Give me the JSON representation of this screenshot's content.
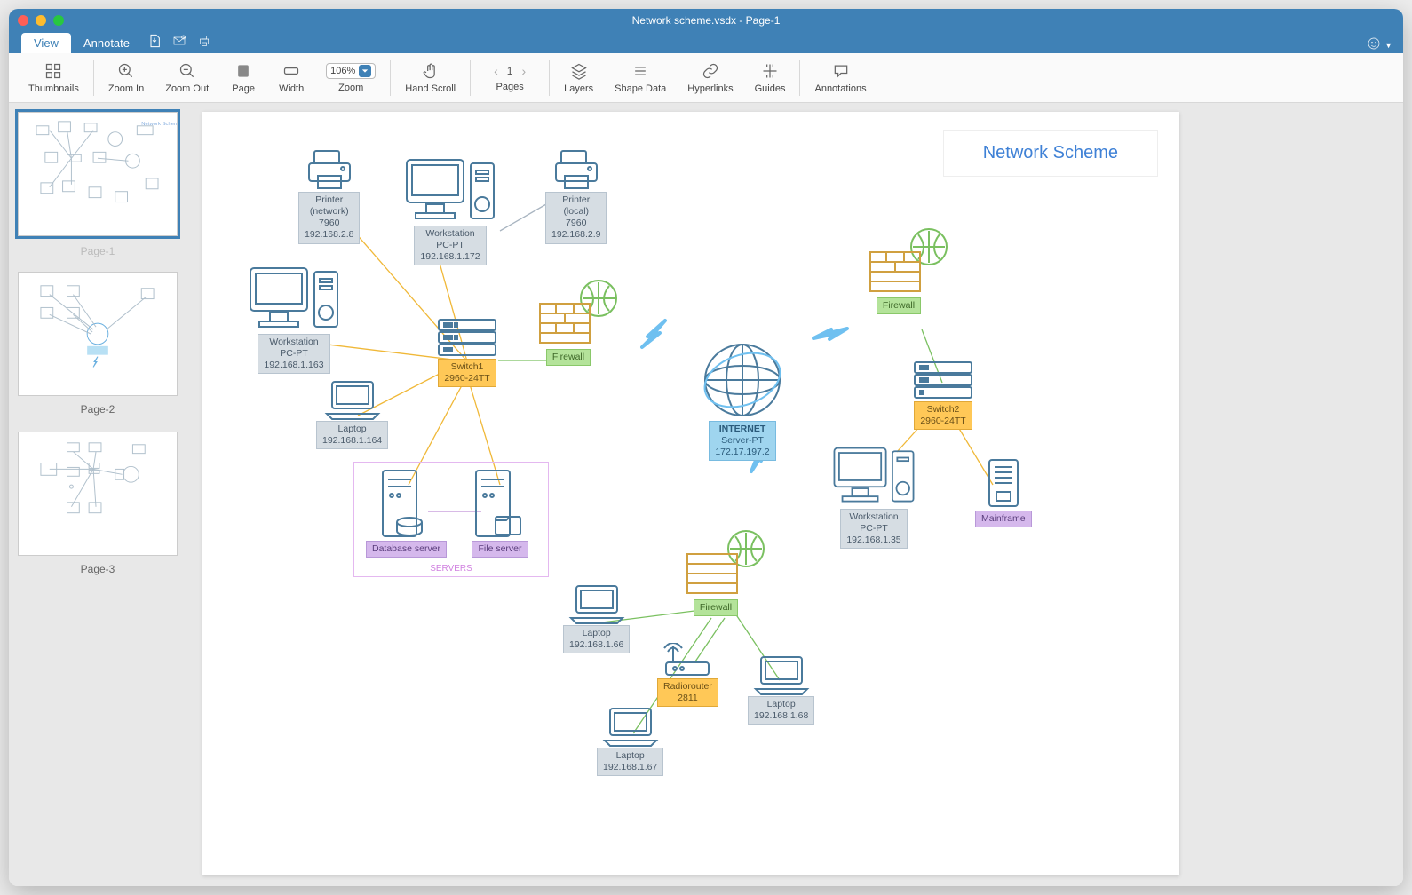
{
  "window": {
    "title": "Network scheme.vsdx - Page-1"
  },
  "tabs": {
    "view": "View",
    "annotate": "Annotate"
  },
  "toolbar": {
    "thumbnails": "Thumbnails",
    "zoom_in": "Zoom In",
    "zoom_out": "Zoom Out",
    "page": "Page",
    "width": "Width",
    "zoom": "Zoom",
    "zoom_value": "106%",
    "hand_scroll": "Hand Scroll",
    "pages": "Pages",
    "page_current": "1",
    "layers": "Layers",
    "shape_data": "Shape Data",
    "hyperlinks": "Hyperlinks",
    "guides": "Guides",
    "annotations": "Annotations"
  },
  "thumbs": {
    "p1": "Page-1",
    "p2": "Page-2",
    "p3": "Page-3"
  },
  "diagram": {
    "title": "Network Scheme",
    "servers_caption": "SERVERS",
    "nodes": {
      "printer_net": {
        "l1": "Printer",
        "l2": "(network)",
        "l3": "7960",
        "l4": "192.168.2.8"
      },
      "printer_local": {
        "l1": "Printer",
        "l2": "(local)",
        "l3": "7960",
        "l4": "192.168.2.9"
      },
      "workstation1": {
        "l1": "Workstation",
        "l2": "PC-PT",
        "l3": "192.168.1.172"
      },
      "workstation2": {
        "l1": "Workstation",
        "l2": "PC-PT",
        "l3": "192.168.1.163"
      },
      "workstation3": {
        "l1": "Workstation",
        "l2": "PC-PT",
        "l3": "192.168.1.35"
      },
      "switch1": {
        "l1": "Switch1",
        "l2": "2960-24TT"
      },
      "switch2": {
        "l1": "Switch2",
        "l2": "2960-24TT"
      },
      "laptop1": {
        "l1": "Laptop",
        "l2": "192.168.1.164"
      },
      "laptop2": {
        "l1": "Laptop",
        "l2": "192.168.1.66"
      },
      "laptop3": {
        "l1": "Laptop",
        "l2": "192.168.1.67"
      },
      "laptop4": {
        "l1": "Laptop",
        "l2": "192.168.1.68"
      },
      "firewall1": {
        "l1": "Firewall"
      },
      "firewall2": {
        "l1": "Firewall"
      },
      "firewall3": {
        "l1": "Firewall"
      },
      "internet": {
        "l1": "INTERNET",
        "l2": "Server-PT",
        "l3": "172.17.197.2"
      },
      "db": {
        "l1": "Database server"
      },
      "file": {
        "l1": "File server"
      },
      "mainframe": {
        "l1": "Mainframe"
      },
      "radio": {
        "l1": "Radiorouter",
        "l2": "2811"
      }
    }
  }
}
